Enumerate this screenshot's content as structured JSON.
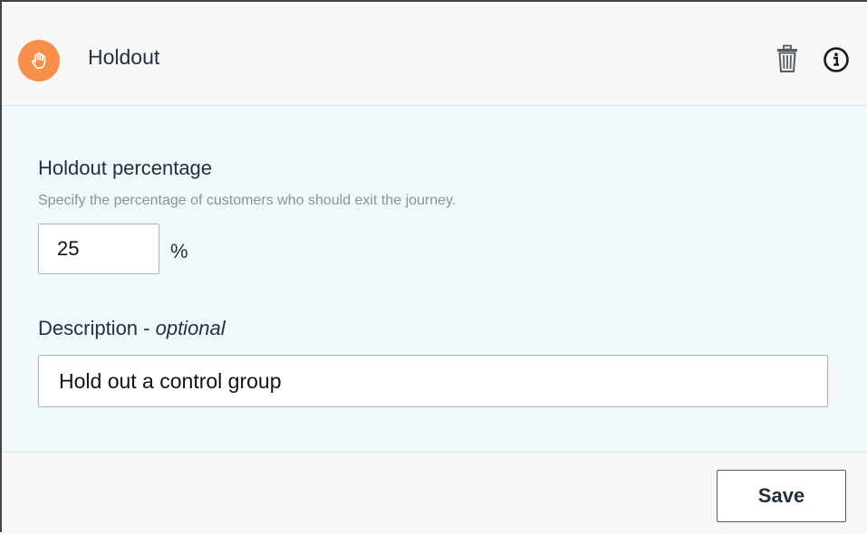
{
  "header": {
    "title": "Holdout",
    "step_icon": "hand-stop-icon",
    "step_icon_color": "#f58f4b",
    "delete_icon": "trash-icon",
    "info_icon": "info-icon"
  },
  "form": {
    "percentage": {
      "label": "Holdout percentage",
      "hint": "Specify the percentage of customers who should exit the journey.",
      "value": "25",
      "unit": "%"
    },
    "description": {
      "label_main": "Description - ",
      "label_optional": "optional",
      "value": "Hold out a control group"
    }
  },
  "footer": {
    "save_label": "Save"
  },
  "colors": {
    "body_background": "#f1f8fc",
    "header_background": "#f7f7f7",
    "text": "#232f3e",
    "hint": "#879596"
  }
}
